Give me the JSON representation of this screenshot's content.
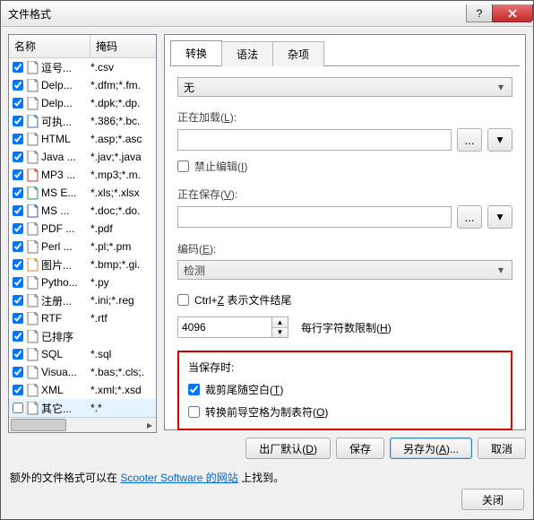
{
  "window": {
    "title": "文件格式"
  },
  "list": {
    "col_name": "名称",
    "col_mask": "掩码",
    "items": [
      {
        "checked": true,
        "icon": "doc",
        "name": "逗号...",
        "mask": "*.csv"
      },
      {
        "checked": true,
        "icon": "doc",
        "name": "Delp...",
        "mask": "*.dfm;*.fm."
      },
      {
        "checked": true,
        "icon": "doc",
        "name": "Delp...",
        "mask": "*.dpk;*.dp."
      },
      {
        "checked": true,
        "icon": "exe",
        "name": "可执...",
        "mask": "*.386;*.bc."
      },
      {
        "checked": true,
        "icon": "doc",
        "name": "HTML",
        "mask": "*.asp;*.asc"
      },
      {
        "checked": true,
        "icon": "doc",
        "name": "Java ...",
        "mask": "*.jav;*.java"
      },
      {
        "checked": true,
        "icon": "mp3",
        "name": "MP3 ...",
        "mask": "*.mp3;*.m."
      },
      {
        "checked": true,
        "icon": "xls",
        "name": "MS E...",
        "mask": "*.xls;*.xlsx"
      },
      {
        "checked": true,
        "icon": "wrd",
        "name": "MS ...",
        "mask": "*.doc;*.do."
      },
      {
        "checked": true,
        "icon": "doc",
        "name": "PDF ...",
        "mask": "*.pdf"
      },
      {
        "checked": true,
        "icon": "doc",
        "name": "Perl ...",
        "mask": "*.pl;*.pm"
      },
      {
        "checked": true,
        "icon": "img",
        "name": "图片...",
        "mask": "*.bmp;*.gi."
      },
      {
        "checked": true,
        "icon": "doc",
        "name": "Pytho...",
        "mask": "*.py"
      },
      {
        "checked": true,
        "icon": "doc",
        "name": "注册...",
        "mask": "*.ini;*.reg"
      },
      {
        "checked": true,
        "icon": "doc",
        "name": "RTF",
        "mask": "*.rtf"
      },
      {
        "checked": true,
        "icon": "tab",
        "name": "已排序",
        "mask": ""
      },
      {
        "checked": true,
        "icon": "doc",
        "name": "SQL",
        "mask": "*.sql"
      },
      {
        "checked": true,
        "icon": "doc",
        "name": "Visua...",
        "mask": "*.bas;*.cls;."
      },
      {
        "checked": true,
        "icon": "doc",
        "name": "XML",
        "mask": "*.xml;*.xsd"
      },
      {
        "checked": false,
        "icon": "doc",
        "name": "其它...",
        "mask": "*.*",
        "sel": true
      }
    ]
  },
  "tabs": {
    "t1": "转换",
    "t2": "语法",
    "t3": "杂项"
  },
  "combo_none": "无",
  "loading": {
    "label": "正在加载",
    "hotkey": "L",
    "forbid": "禁止编辑",
    "forbid_hotkey": "I"
  },
  "saving": {
    "label": "正在保存",
    "hotkey": "V"
  },
  "encoding": {
    "label": "编码",
    "hotkey": "E",
    "value": "检测"
  },
  "ctrlz": {
    "label": "表示文件结尾",
    "prefix": "Ctrl+",
    "key": "Z"
  },
  "limit": {
    "value": "4096",
    "label": "每行字符数限制",
    "hotkey": "H"
  },
  "onsave": {
    "title": "当保存时:",
    "trim": {
      "checked": true,
      "label": "裁剪尾随空白",
      "hotkey": "T"
    },
    "tabs": {
      "checked": false,
      "label": "转换前导空格为制表符",
      "hotkey": "O"
    }
  },
  "footer": {
    "defaults": "出厂默认",
    "defaults_hotkey": "D",
    "save": "保存",
    "saveas": "另存为",
    "saveas_hotkey": "A",
    "cancel": "取消"
  },
  "footnote": {
    "prefix": "额外的文件格式可以在 ",
    "link": "Scooter Software 的网站",
    "suffix": " 上找到。"
  },
  "close": "关闭"
}
